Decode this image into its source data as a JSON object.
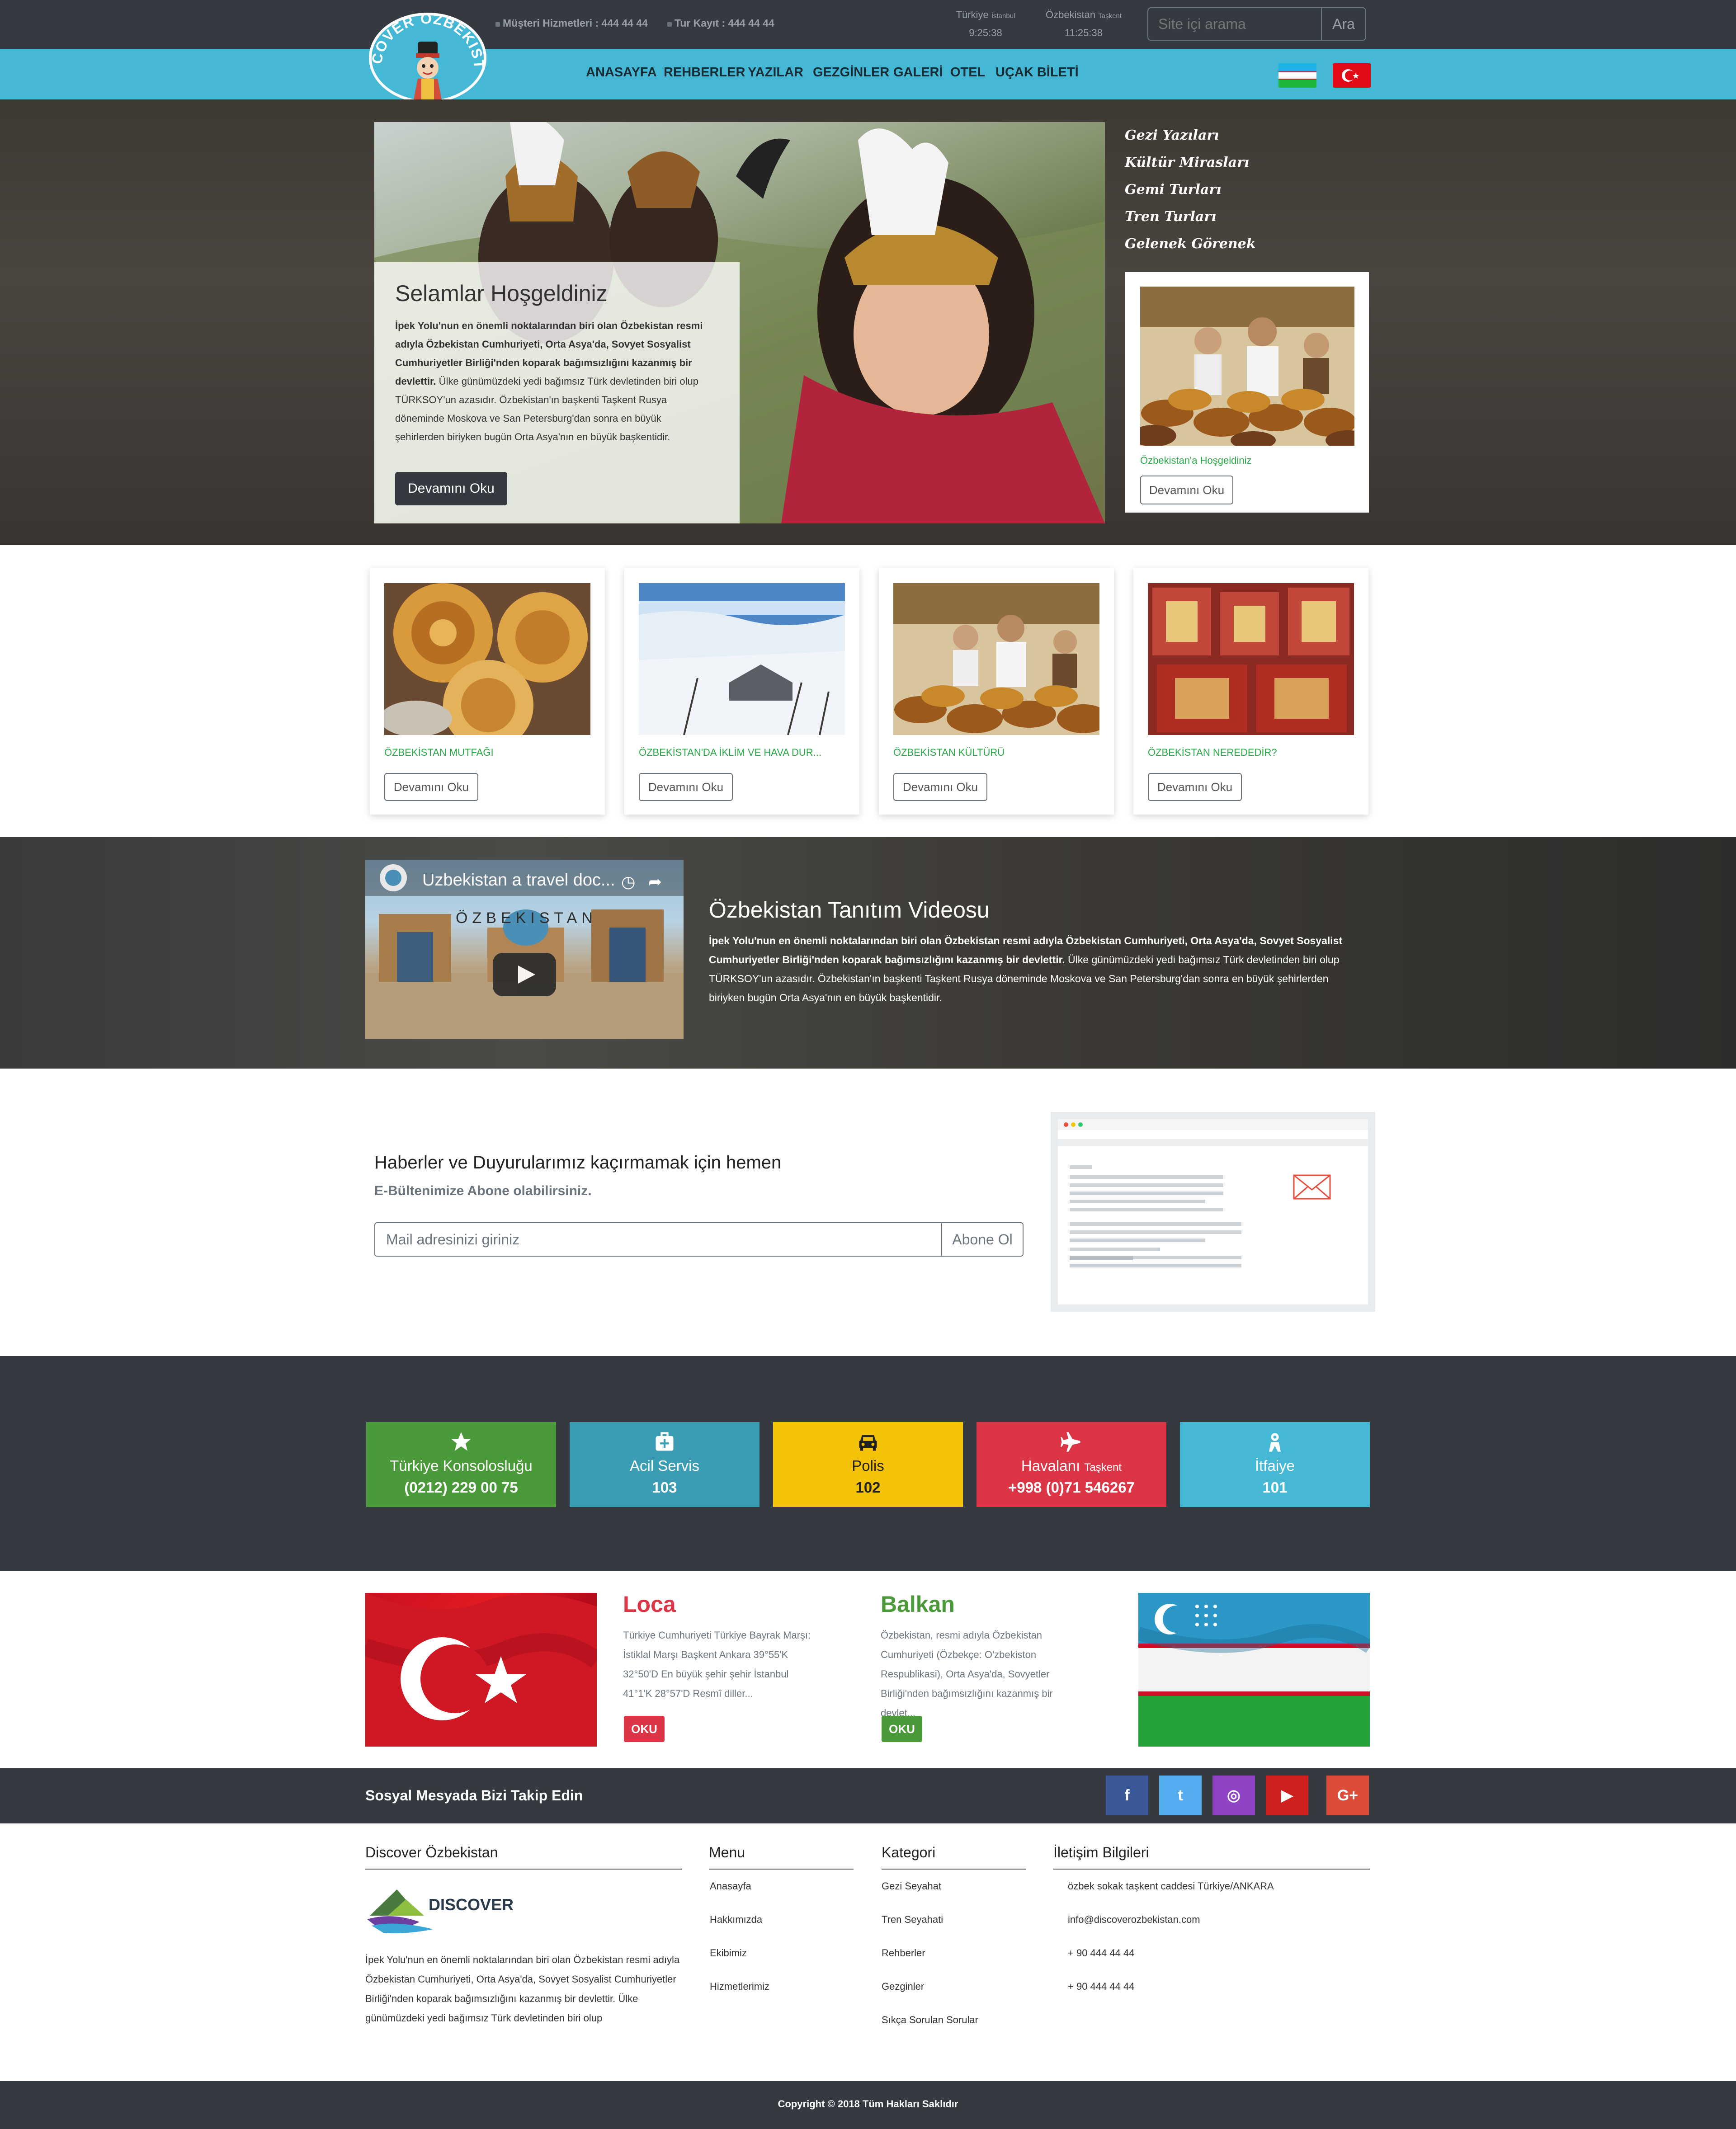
{
  "topbar": {
    "customer_service": "Müşteri Hizmetleri : 444 44 44",
    "tour_booking": "Tur Kayıt : 444 44 44",
    "clock_tr": {
      "country": "Türkiye",
      "city": "İstanbul",
      "time": "9:25:38"
    },
    "clock_uz": {
      "country": "Özbekistan",
      "city": "Taşkent",
      "time": "11:25:38"
    },
    "search": {
      "placeholder": "Site içi arama",
      "button": "Ara"
    }
  },
  "logo": {
    "text": "DISCOVER ÖZBEKISTAN"
  },
  "nav": {
    "items": [
      "ANASAYFA",
      "REHBERLER",
      "YAZILAR",
      "GEZGİNLER",
      "GALERİ",
      "OTEL",
      "UÇAK BİLETİ"
    ]
  },
  "hero": {
    "title": "Selamlar Hoşgeldiniz",
    "text_bold": "İpek Yolu'nun en önemli noktalarından biri olan Özbekistan resmi adıyla Özbekistan Cumhuriyeti, Orta Asya'da, Sovyet Sosyalist Cumhuriyetler Birliği'nden koparak bağımsızlığını kazanmış bir devlettir.",
    "text_normal": " Ülke günümüzdeki yedi bağımsız Türk devletinden biri olup TÜRKSOY'un azasıdır. Özbekistan'ın başkenti Taşkent Rusya döneminde Moskova ve San Petersburg'dan sonra en büyük şehirlerden biriyken bugün Orta Asya'nın en büyük başkentidir.",
    "button": "Devamını Oku"
  },
  "side_menu": {
    "items": [
      "Gezi Yazıları",
      "Kültür Mirasları",
      "Gemi Turları",
      "Tren Turları",
      "Gelenek Görenek"
    ]
  },
  "side_card": {
    "caption": "Özbekistan'a Hoşgeldiniz",
    "button": "Devamını Oku"
  },
  "cards": [
    {
      "caption": "ÖZBEKİSTAN MUTFAĞI",
      "button": "Devamını Oku"
    },
    {
      "caption": "ÖZBEKİSTAN'DA İKLİM VE HAVA DUR...",
      "button": "Devamını Oku"
    },
    {
      "caption": "ÖZBEKİSTAN KÜLTÜRÜ",
      "button": "Devamını Oku"
    },
    {
      "caption": "ÖZBEKİSTAN NEREDEDİR?",
      "button": "Devamını Oku"
    }
  ],
  "video": {
    "embed_title": "Uzbekistan a travel doc...",
    "embed_overlay": "ÖZBEKISTAN",
    "heading": "Özbekistan Tanıtım Videosu",
    "text_bold": "İpek Yolu'nun en önemli noktalarından biri olan Özbekistan resmi adıyla Özbekistan Cumhuriyeti, Orta Asya'da, Sovyet Sosyalist Cumhuriyetler Birliği'nden koparak bağımsızlığını kazanmış bir devlettir.",
    "text_normal": " Ülke günümüzdeki yedi bağımsız Türk devletinden biri olup TÜRKSOY'un azasıdır. Özbekistan'ın başkenti Taşkent Rusya döneminde Moskova ve San Petersburg'dan sonra en büyük şehirlerden biriyken bugün Orta Asya'nın en büyük başkentidir."
  },
  "newsletter": {
    "heading": "Haberler ve Duyurularımız kaçırmamak için hemen",
    "sub": "E-Bültenimize Abone olabilirsiniz.",
    "placeholder": "Mail adresinizi giriniz",
    "button": "Abone Ol"
  },
  "emergency": [
    {
      "icon": "star-icon",
      "label": "Türkiye Konsolosluğu",
      "label_small": "",
      "number": "(0212) 229 00 75",
      "color": "#4a9a3a"
    },
    {
      "icon": "medkit-icon",
      "label": "Acil Servis",
      "label_small": "",
      "number": "103",
      "color": "#3a9db4"
    },
    {
      "icon": "car-icon",
      "label": "Polis",
      "label_small": "",
      "number": "102",
      "color": "#f5c20a"
    },
    {
      "icon": "plane-icon",
      "label": "Havalanı",
      "label_small": "Taşkent",
      "number": "+998 (0)71 546267",
      "color": "#dc3545"
    },
    {
      "icon": "fire-icon",
      "label": "İtfaiye",
      "label_small": "",
      "number": "101",
      "color": "#45b8d6"
    }
  ],
  "info": {
    "loca": {
      "title": "Loca",
      "text": "Türkiye Cumhuriyeti Türkiye Bayrak Marşı: İstiklal Marşı Başkent Ankara 39°55'K 32°50'D En büyük şehir şehir İstanbul 41°1'K 28°57'D Resmî diller...",
      "button": "OKU",
      "color": "#dc3545"
    },
    "balkan": {
      "title": "Balkan",
      "text": "Özbekistan, resmi adıyla Özbekistan Cumhuriyeti (Özbekçe: O'zbekiston Respublikasi), Orta Asya'da, Sovyetler Birliği'nden bağımsızlığını kazanmış bir devlet...",
      "button": "OKU",
      "color": "#4a9a3a"
    }
  },
  "social": {
    "text": "Sosyal Mesyada Bizi Takip Edin",
    "buttons": [
      {
        "icon": "facebook-icon",
        "glyph": "f",
        "color": "#3b5998"
      },
      {
        "icon": "twitter-icon",
        "glyph": "t",
        "color": "#55acee"
      },
      {
        "icon": "instagram-icon",
        "glyph": "◎",
        "color": "#8e44c4"
      },
      {
        "icon": "youtube-icon",
        "glyph": "▶",
        "color": "#cd201f"
      },
      {
        "icon": "google-plus-icon",
        "glyph": "G+",
        "color": "#dd4b39"
      }
    ]
  },
  "footer": {
    "about_title": "Discover Özbekistan",
    "logo_text": "DISCOVER",
    "about_text": "İpek Yolu'nun en önemli noktalarından biri olan Özbekistan resmi adıyla Özbekistan Cumhuriyeti, Orta Asya'da, Sovyet Sosyalist Cumhuriyetler Birliği'nden koparak bağımsızlığını kazanmış bir devlettir. Ülke günümüzdeki yedi bağımsız Türk devletinden biri olup",
    "menu_title": "Menu",
    "menu": [
      "Anasayfa",
      "Hakkımızda",
      "Ekibimiz",
      "Hizmetlerimiz"
    ],
    "category_title": "Kategori",
    "categories": [
      "Gezi Seyahat",
      "Tren Seyahati",
      "Rehberler",
      "Gezginler",
      "Sıkça Sorulan Sorular"
    ],
    "contact_title": "İletişim Bilgileri",
    "contact": [
      "özbek sokak taşkent caddesi Türkiye/ANKARA",
      "info@discoverozbekistan.com",
      "+ 90 444 44 44",
      "+ 90 444 44 44"
    ],
    "copyright": "Copyright © 2018 Tüm Hakları Saklıdır"
  }
}
